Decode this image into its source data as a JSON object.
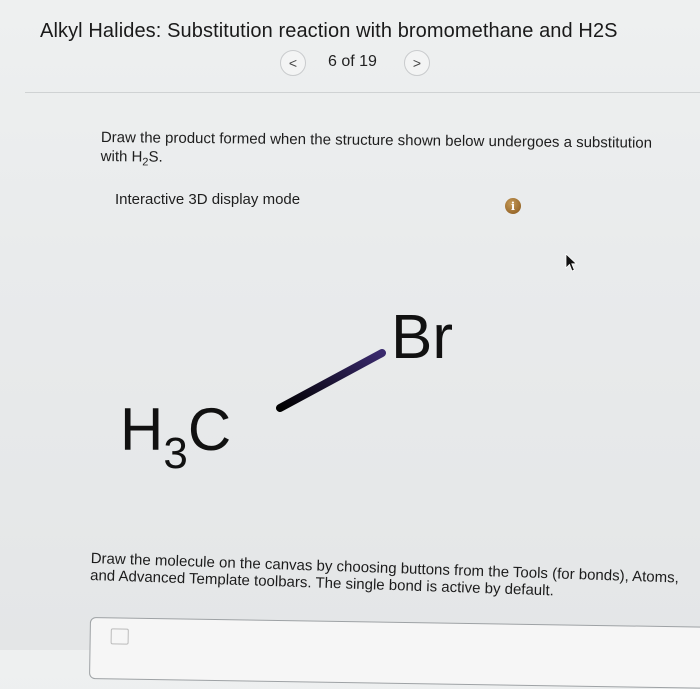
{
  "header": {
    "title": "Alkyl Halides: Substitution reaction with bromomethane and H2S",
    "pager": {
      "prev_glyph": "<",
      "counter": "6 of 19",
      "next_glyph": ">"
    }
  },
  "question": {
    "text_before_formula": "Draw the product formed when the structure shown below undergoes a substitution with ",
    "formula": {
      "main": "H",
      "subscript": "2",
      "tail": "S."
    }
  },
  "display_mode": {
    "label": "Interactive 3D display mode"
  },
  "info_icon": {
    "glyph": "i"
  },
  "molecule": {
    "atoms": [
      {
        "main": "H",
        "subscript": "3",
        "tail": "C"
      },
      {
        "label": "Br"
      }
    ],
    "bond": "single",
    "bond_color_from": "#000000",
    "bond_color_to": "#3a2a6e"
  },
  "instructions": {
    "text": "Draw the molecule on the canvas by choosing buttons from the Tools (for bonds), Atoms, and Advanced Template toolbars. The single bond is active by default."
  },
  "colors": {
    "info": "#a5743a",
    "text": "#1c1c1c",
    "divider": "#cfd2d3"
  }
}
